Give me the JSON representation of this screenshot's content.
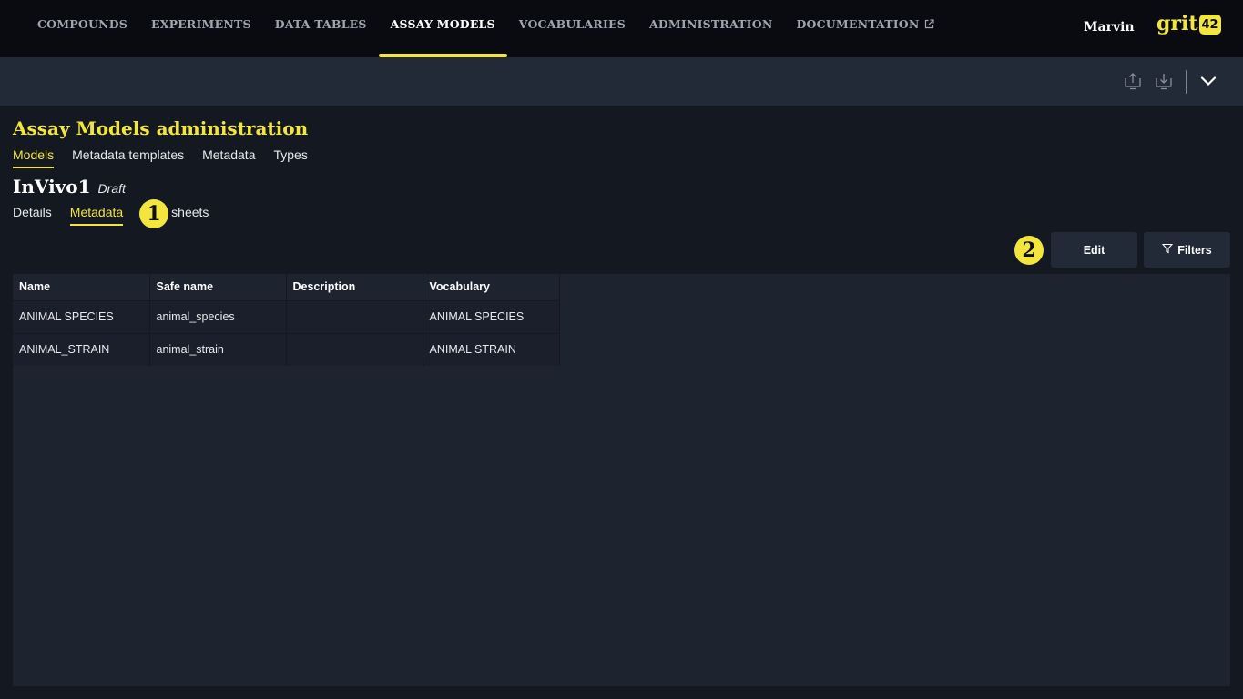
{
  "nav": {
    "items": [
      {
        "label": "COMPOUNDS",
        "active": false
      },
      {
        "label": "EXPERIMENTS",
        "active": false
      },
      {
        "label": "DATA TABLES",
        "active": false
      },
      {
        "label": "ASSAY MODELS",
        "active": true
      },
      {
        "label": "VOCABULARIES",
        "active": false
      },
      {
        "label": "ADMINISTRATION",
        "active": false
      },
      {
        "label": "DOCUMENTATION",
        "active": false,
        "external": true
      }
    ],
    "user": "Marvin",
    "logo_text": "grit",
    "logo_badge": "42"
  },
  "toolbar": {
    "icons": [
      "upload-icon",
      "download-icon",
      "chevron-down-icon"
    ]
  },
  "page": {
    "title": "Assay Models administration",
    "tabs": [
      {
        "label": "Models",
        "active": true
      },
      {
        "label": "Metadata templates",
        "active": false
      },
      {
        "label": "Metadata",
        "active": false
      },
      {
        "label": "Types",
        "active": false
      }
    ]
  },
  "entity": {
    "name": "InVivo1",
    "status": "Draft",
    "tabs": [
      {
        "label": "Details",
        "active": false
      },
      {
        "label": "Metadata",
        "active": true
      },
      {
        "label": "sheets",
        "active": false
      }
    ]
  },
  "markers": [
    "1",
    "2"
  ],
  "actions": {
    "edit_label": "Edit",
    "filters_label": "Filters"
  },
  "table": {
    "columns": [
      "Name",
      "Safe name",
      "Description",
      "Vocabulary"
    ],
    "rows": [
      [
        "ANIMAL SPECIES",
        "animal_species",
        "",
        "ANIMAL SPECIES"
      ],
      [
        "ANIMAL_STRAIN",
        "animal_strain",
        "",
        "ANIMAL STRAIN"
      ]
    ]
  },
  "colors": {
    "accent": "#f2e63d",
    "topbar_bg": "#090b10",
    "page_bg": "#141821",
    "toolbar_bg": "#232a37"
  }
}
